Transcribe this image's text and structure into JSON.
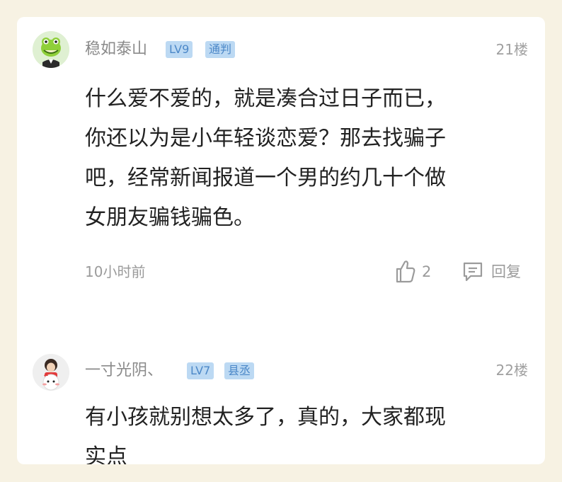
{
  "comments": [
    {
      "username": "稳如泰山",
      "level": "LV9",
      "title": "通判",
      "floor": "21楼",
      "lines": [
        "什么爱不爱的，就是凑合过日子而已，",
        "你还以为是小年轻谈恋爱？那去找骗子",
        "吧，经常新闻报道一个男的约几十个做",
        "女朋友骗钱骗色。"
      ],
      "time": "10小时前",
      "likes": "2",
      "reply_label": "回复"
    },
    {
      "username": "一寸光阴、",
      "level": "LV7",
      "title": "县丞",
      "floor": "22楼",
      "lines": [
        "有小孩就别想太多了，真的，大家都现",
        "实点"
      ]
    }
  ],
  "icons": {
    "like": "thumbs-up-icon",
    "reply": "comment-bubble-icon"
  },
  "colors": {
    "page_bg": "#f7f2e3",
    "card_bg": "#ffffff",
    "badge_bg": "#bcd9f3",
    "badge_text": "#4c88c8",
    "meta_text": "#9b9b9b",
    "body_text": "#222222"
  }
}
